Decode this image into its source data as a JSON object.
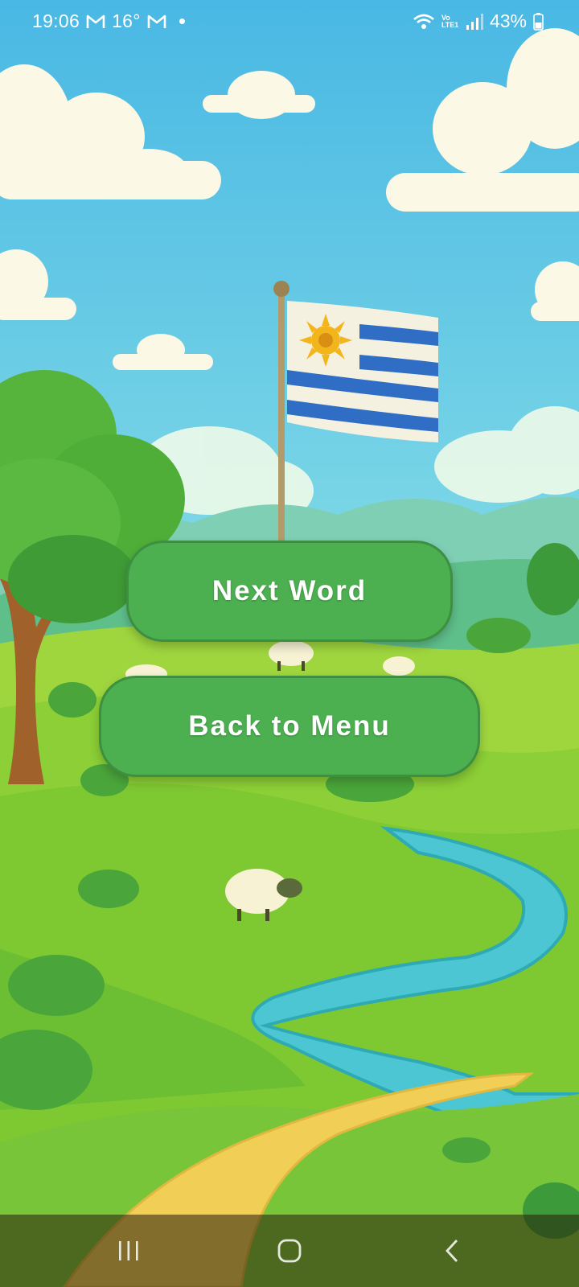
{
  "status_bar": {
    "time": "19:06",
    "temperature": "16°",
    "battery": "43%",
    "network_label": "Vo LTE1",
    "icons": [
      "gmail-icon",
      "gmail-icon",
      "notification-dot-icon",
      "wifi-icon",
      "lte-icon",
      "signal-icon",
      "battery-icon"
    ]
  },
  "scene": {
    "description_icons": [
      "flag-of-uruguay-icon",
      "sheep-icon",
      "tree-icon",
      "river-icon",
      "cloud-icon"
    ],
    "flag": {
      "stripe_color": "#2f6ec4",
      "field_color": "#f5f1e1",
      "sun_color": "#f2b51c"
    }
  },
  "buttons": {
    "next_word": "Next Word",
    "back_to_menu": "Back to Menu",
    "color": "#4caf50"
  },
  "nav_bar": {
    "icons": [
      "recent-apps-icon",
      "home-icon",
      "back-icon"
    ]
  }
}
